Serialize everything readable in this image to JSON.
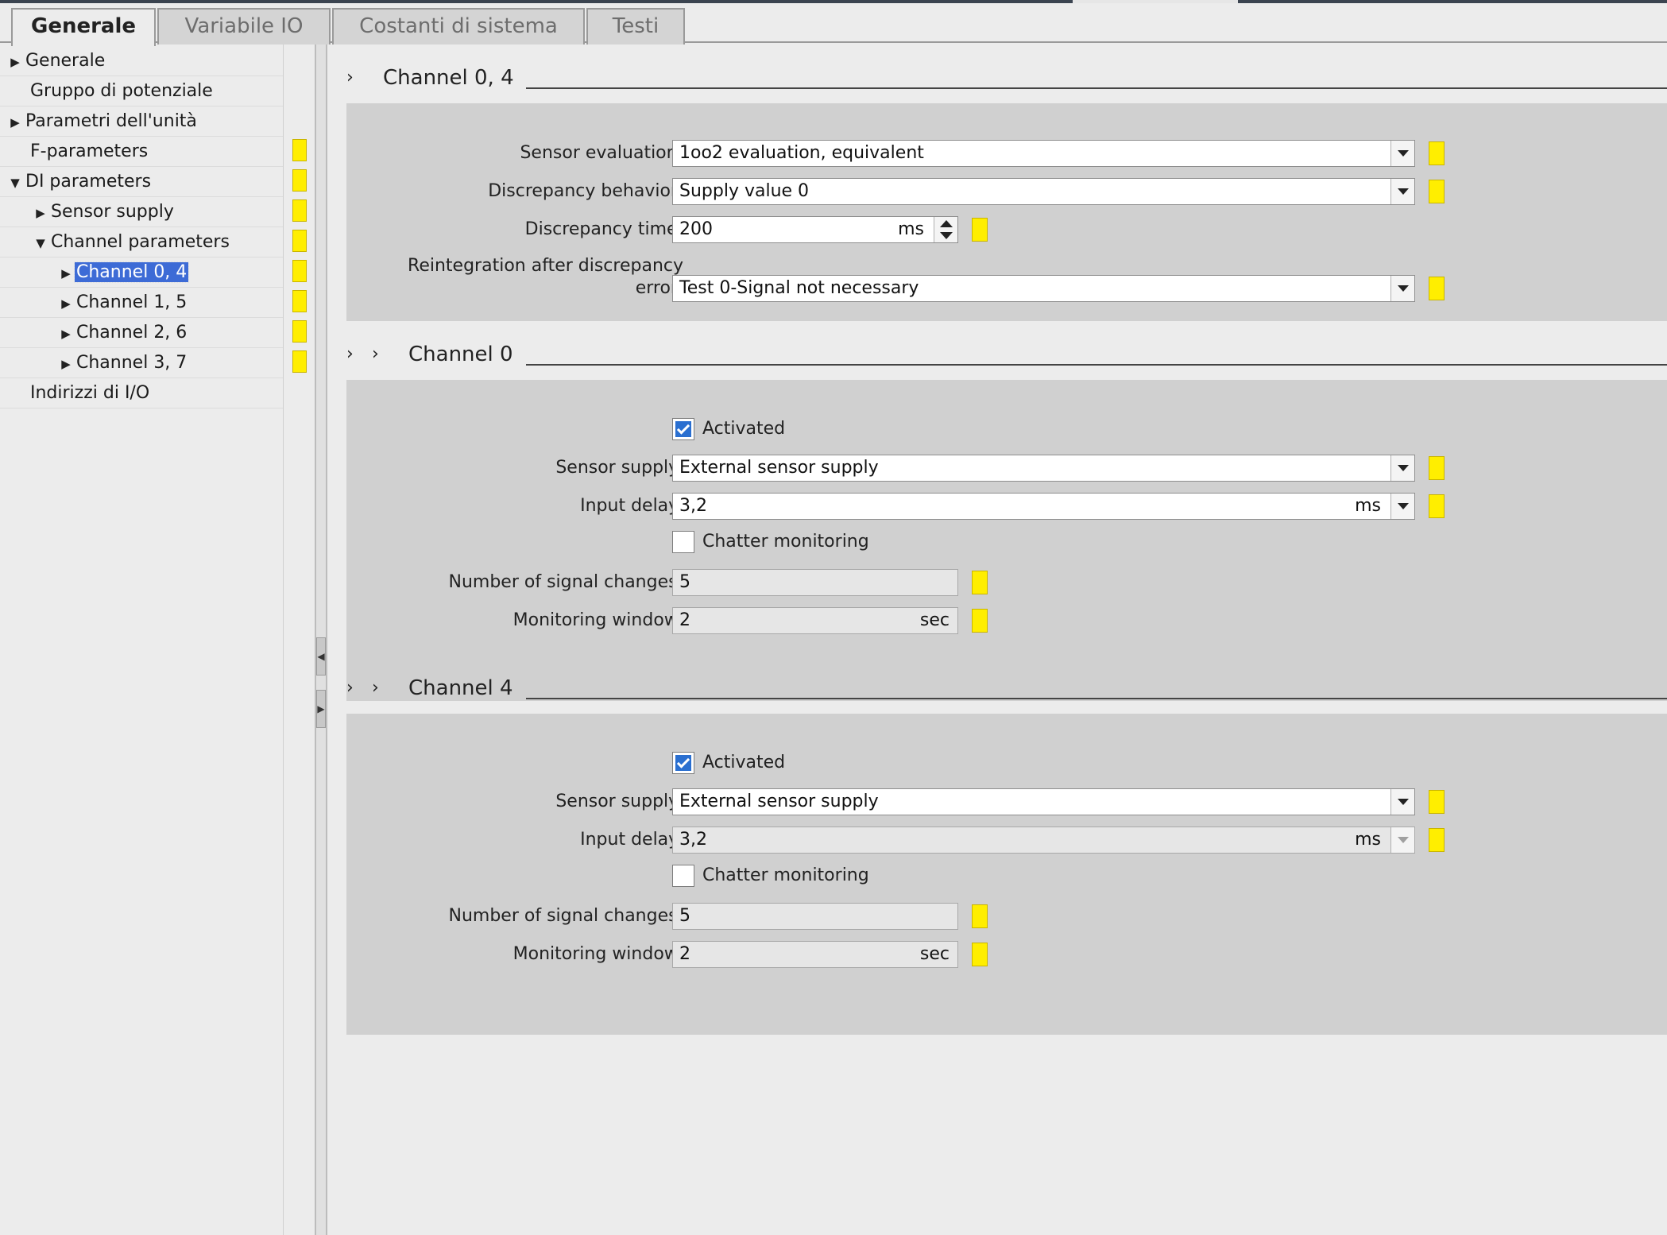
{
  "tabs": [
    "Generale",
    "Variabile IO",
    "Costanti di sistema",
    "Testi"
  ],
  "nav": {
    "items": [
      {
        "label": "Generale"
      },
      {
        "label": "Gruppo di potenziale"
      },
      {
        "label": "Parametri dell'unità"
      },
      {
        "label": "F-parameters"
      },
      {
        "label": "DI parameters"
      },
      {
        "label": "Sensor supply"
      },
      {
        "label": "Channel parameters"
      },
      {
        "label": "Channel 0, 4"
      },
      {
        "label": "Channel 1, 5"
      },
      {
        "label": "Channel 2, 6"
      },
      {
        "label": "Channel 3, 7"
      },
      {
        "label": "Indirizzi di I/O"
      }
    ]
  },
  "sections": {
    "ch04": {
      "title": "Channel 0, 4",
      "sensor_eval_label": "Sensor evaluation:",
      "sensor_eval_value": "1oo2 evaluation, equivalent",
      "disc_behavior_label": "Discrepancy behavior:",
      "disc_behavior_value": "Supply value 0",
      "disc_time_label": "Discrepancy time:",
      "disc_time_value": "200",
      "disc_time_unit": "ms",
      "reint_label_1": "Reintegration after discrepancy",
      "reint_label_2": "error:",
      "reint_value": "Test 0-Signal not necessary"
    },
    "ch0": {
      "title": "Channel 0",
      "activated_label": "Activated",
      "sensor_supply_label": "Sensor supply:",
      "sensor_supply_value": "External sensor supply",
      "input_delay_label": "Input delay:",
      "input_delay_value": "3,2",
      "input_delay_unit": "ms",
      "chatter_label": "Chatter monitoring",
      "signal_changes_label": "Number of signal changes:",
      "signal_changes_value": "5",
      "mon_window_label": "Monitoring window:",
      "mon_window_value": "2",
      "mon_window_unit": "sec"
    },
    "ch4": {
      "title": "Channel 4",
      "activated_label": "Activated",
      "sensor_supply_label": "Sensor supply:",
      "sensor_supply_value": "External sensor supply",
      "input_delay_label": "Input delay:",
      "input_delay_value": "3,2",
      "input_delay_unit": "ms",
      "chatter_label": "Chatter monitoring",
      "signal_changes_label": "Number of signal changes:",
      "signal_changes_value": "5",
      "mon_window_label": "Monitoring window:",
      "mon_window_value": "2",
      "mon_window_unit": "sec"
    }
  },
  "colors": {
    "marker": "#ffee00",
    "selection": "#3d6bd6",
    "panel": "#d0d0d0"
  }
}
